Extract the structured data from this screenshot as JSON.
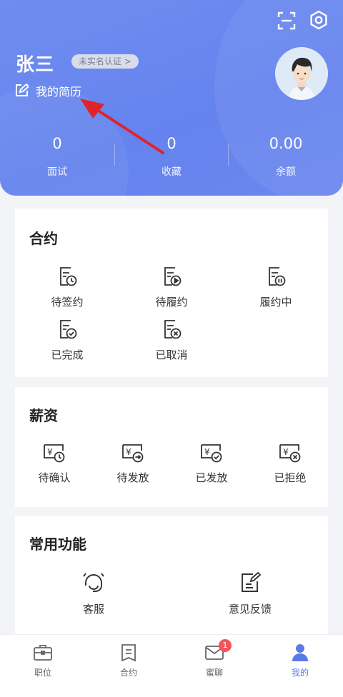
{
  "header": {
    "user_name": "张三",
    "verify_badge": "未实名认证 >",
    "resume_link": "我的简历",
    "stats": [
      {
        "value": "0",
        "label": "面试"
      },
      {
        "value": "0",
        "label": "收藏"
      },
      {
        "value": "0.00",
        "label": "余额"
      }
    ]
  },
  "contract": {
    "title": "合约",
    "items": [
      {
        "label": "待签约",
        "icon": "contract-pending-sign-icon"
      },
      {
        "label": "待履约",
        "icon": "contract-pending-perform-icon"
      },
      {
        "label": "履约中",
        "icon": "contract-performing-icon"
      },
      {
        "label": "已完成",
        "icon": "contract-completed-icon"
      },
      {
        "label": "已取消",
        "icon": "contract-cancelled-icon"
      }
    ]
  },
  "salary": {
    "title": "薪资",
    "items": [
      {
        "label": "待确认",
        "icon": "salary-pending-confirm-icon"
      },
      {
        "label": "待发放",
        "icon": "salary-pending-payout-icon"
      },
      {
        "label": "已发放",
        "icon": "salary-paid-icon"
      },
      {
        "label": "已拒绝",
        "icon": "salary-rejected-icon"
      }
    ]
  },
  "features": {
    "title": "常用功能",
    "items": [
      {
        "label": "客服",
        "icon": "customer-service-icon"
      },
      {
        "label": "意见反馈",
        "icon": "feedback-icon"
      }
    ]
  },
  "tabbar": {
    "tabs": [
      {
        "label": "职位",
        "icon": "briefcase-icon"
      },
      {
        "label": "合约",
        "icon": "contract-icon"
      },
      {
        "label": "蜜聊",
        "icon": "mail-icon",
        "badge": "1"
      },
      {
        "label": "我的",
        "icon": "person-icon",
        "active": true
      }
    ]
  },
  "colors": {
    "accent": "#5a7ae8",
    "header_bg": "#6a87ef",
    "annotation_arrow": "#e0232a",
    "badge": "#f2555a"
  }
}
